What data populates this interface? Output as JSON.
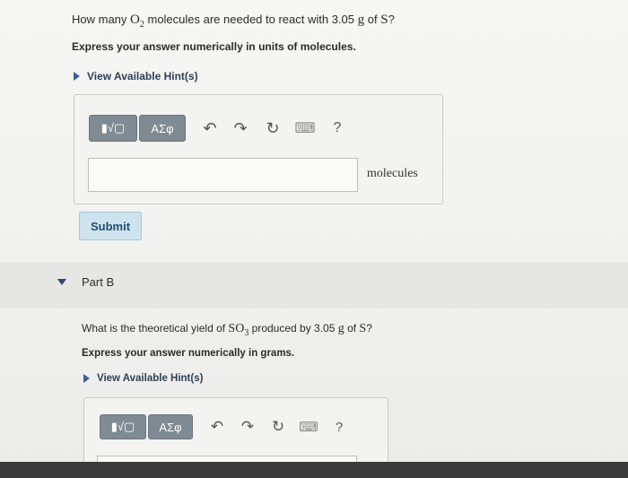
{
  "partA": {
    "question_prefix": "How many ",
    "molecule": "O",
    "molecule_sub": "2",
    "question_mid": " molecules are needed to react with 3.05 ",
    "unit_g": "g",
    "question_of": " of ",
    "element": "S",
    "question_end": "?",
    "instruction": "Express your answer numerically in units of molecules.",
    "hint_label": "View Available Hint(s)",
    "units_label": "molecules",
    "submit_label": "Submit"
  },
  "toolbar": {
    "templates_label": "▮√▢",
    "greek_label": "ΑΣφ",
    "undo_glyph": "↶",
    "redo_glyph": "↷",
    "reset_glyph": "↻",
    "keyboard_glyph": "⌨",
    "help_glyph": "?"
  },
  "partB": {
    "label": "Part B",
    "question_prefix": "What is the theoretical yield of ",
    "compound": "SO",
    "compound_sub": "3",
    "question_mid": " produced by 3.05 ",
    "unit_g": "g",
    "question_of": " of ",
    "element": "S",
    "question_end": "?",
    "instruction": "Express your answer numerically in grams.",
    "hint_label": "View Available Hint(s)"
  },
  "icons": {
    "hint": "triangle-right-icon",
    "collapse": "triangle-down-icon",
    "undo": "undo-icon",
    "redo": "redo-icon",
    "reset": "reset-icon",
    "keyboard": "keyboard-icon",
    "help": "help-icon"
  },
  "colors": {
    "toolbar_button": "#7f8a93",
    "submit_bg": "#cfe3ef",
    "hint_triangle": "#3a5f95"
  }
}
